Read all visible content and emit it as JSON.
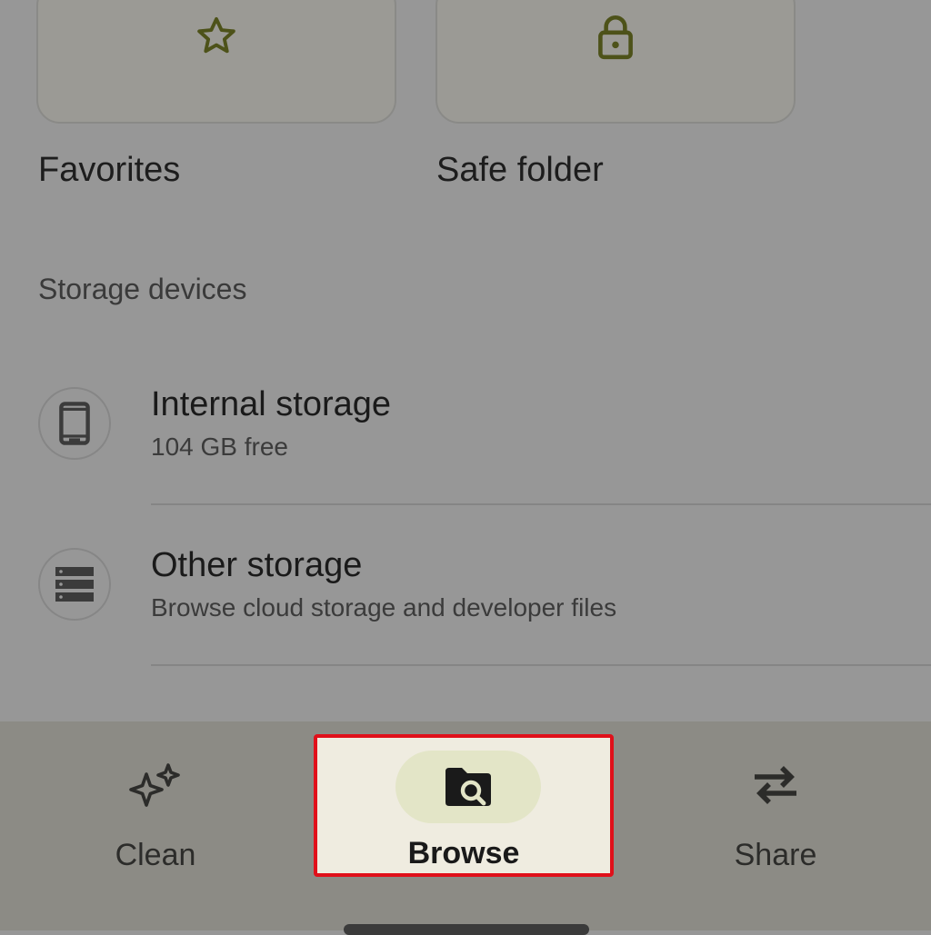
{
  "tiles": [
    {
      "label": "Favorites",
      "icon": "star-icon"
    },
    {
      "label": "Safe folder",
      "icon": "lock-icon"
    }
  ],
  "storage": {
    "heading": "Storage devices",
    "items": [
      {
        "title": "Internal storage",
        "subtitle": "104 GB free",
        "icon": "phone-icon"
      },
      {
        "title": "Other storage",
        "subtitle": "Browse cloud storage and developer files",
        "icon": "server-icon"
      }
    ]
  },
  "nav": {
    "items": [
      {
        "label": "Clean",
        "icon": "sparkle-icon"
      },
      {
        "label": "Browse",
        "icon": "folder-search-icon",
        "selected": true
      },
      {
        "label": "Share",
        "icon": "swap-arrows-icon"
      }
    ]
  },
  "colors": {
    "highlight_border": "#e0101a",
    "selected_pill": "#e3e5c7",
    "accent_icon": "#4d5219"
  }
}
